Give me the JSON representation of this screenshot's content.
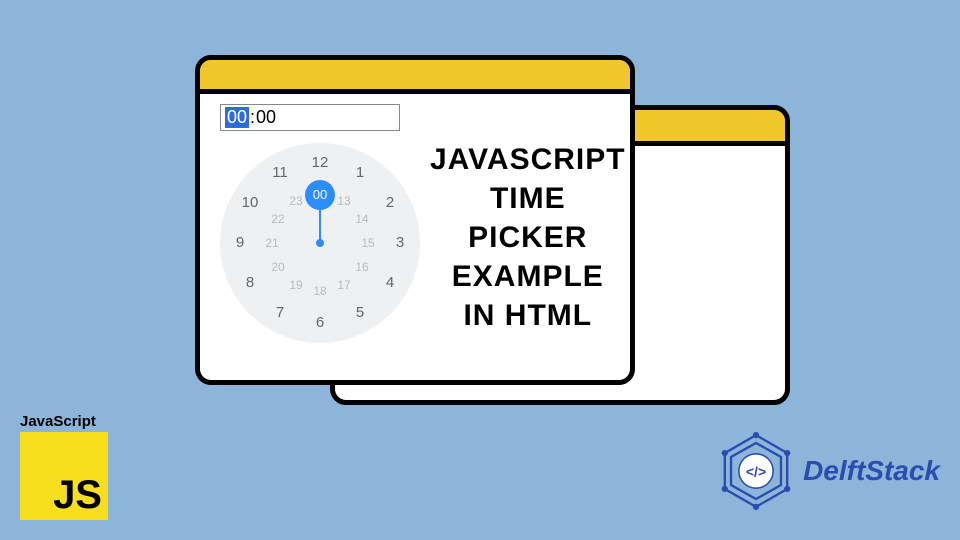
{
  "colors": {
    "bg": "#8db4d9",
    "titlebar": "#f0c62a",
    "accent": "#2d8cff",
    "js_badge": "#f7df1e",
    "brand_blue": "#2a4db0"
  },
  "time_input": {
    "hours": "00",
    "separator": ":",
    "minutes": "00"
  },
  "clock": {
    "outer_hours": [
      "12",
      "1",
      "2",
      "3",
      "4",
      "5",
      "6",
      "7",
      "8",
      "9",
      "10",
      "11"
    ],
    "inner_hours": [
      "00",
      "13",
      "14",
      "15",
      "16",
      "17",
      "18",
      "19",
      "20",
      "21",
      "22",
      "23"
    ],
    "selected_inner": "00"
  },
  "headline": {
    "line1": "JavaScript",
    "line2": "Time Picker",
    "line3": "Example",
    "line4": "in HTML"
  },
  "js_badge": {
    "label": "JavaScript",
    "short": "JS"
  },
  "brand": {
    "name": "DelftStack",
    "tag_open": "<",
    "tag_slash": "/",
    "tag_close": ">"
  }
}
